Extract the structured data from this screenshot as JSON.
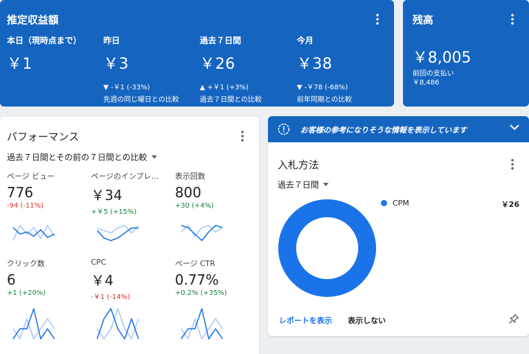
{
  "earnings": {
    "title": "推定収益額",
    "metrics": [
      {
        "label": "本日（現時点まで）",
        "value": "￥1",
        "change": "",
        "compare": ""
      },
      {
        "label": "昨日",
        "value": "￥3",
        "change": "▼ -￥1 (-33%)",
        "compare": "先週の同じ曜日との比較"
      },
      {
        "label": "過去７日間",
        "value": "￥26",
        "change": "▲ +￥1 (+3%)",
        "compare": "過去７日間との比較"
      },
      {
        "label": "今月",
        "value": "￥38",
        "change": "▼ -￥78 (-68%)",
        "compare": "前年同期との比較"
      }
    ]
  },
  "balance": {
    "title": "残高",
    "value": "￥8,005",
    "last_payment_label": "前回の支払い",
    "last_payment_value": "￥8,486"
  },
  "performance": {
    "title": "パフォーマンス",
    "period": "過去７日間とその前の７日間との比較",
    "metrics": [
      {
        "label": "ページ ビュー",
        "value": "776",
        "change": "-94 (-11%)",
        "trend": "down",
        "current": [
          20,
          14,
          16,
          12,
          18,
          11,
          14
        ],
        "previous": [
          8,
          22,
          14,
          20,
          10,
          22,
          12
        ]
      },
      {
        "label": "ページのインプレ…",
        "value": "￥34",
        "change": "+￥5 (+15%)",
        "trend": "up",
        "current": [
          18,
          12,
          10,
          12,
          16,
          20,
          20
        ],
        "previous": [
          20,
          18,
          16,
          20,
          22,
          16,
          22
        ]
      },
      {
        "label": "表示回数",
        "value": "800",
        "change": "+30 (+4%)",
        "trend": "up",
        "current": [
          20,
          18,
          12,
          6,
          14,
          20,
          18
        ],
        "previous": [
          14,
          20,
          10,
          18,
          20,
          14,
          18
        ]
      },
      {
        "label": "クリック数",
        "value": "6",
        "change": "+1 (+20%)",
        "trend": "up",
        "current": [
          0,
          1,
          1,
          3,
          0,
          1,
          0
        ],
        "previous": [
          1,
          0,
          2,
          0,
          1,
          2,
          1
        ]
      },
      {
        "label": "CPC",
        "value": "￥4",
        "change": "-￥1 (-14%)",
        "trend": "down",
        "current": [
          0,
          2,
          3,
          1,
          0,
          2,
          0
        ],
        "previous": [
          1,
          0,
          1,
          3,
          1,
          0,
          2
        ]
      },
      {
        "label": "ページ CTR",
        "value": "0.77%",
        "change": "+0.2% (+35%)",
        "trend": "up",
        "current": [
          0,
          1,
          1,
          3,
          0,
          1,
          0
        ],
        "previous": [
          1,
          0,
          2,
          0,
          1,
          2,
          1
        ]
      }
    ]
  },
  "banner": {
    "text": "お客様の参考になりそうな情報を表示しています"
  },
  "bid": {
    "title": "入札方法",
    "period": "過去７日間",
    "legend": [
      {
        "name": "CPM",
        "value": "￥26",
        "share": 1.0,
        "color": "#1a73e8"
      }
    ],
    "view_report": "レポートを表示",
    "hide": "表示しない"
  },
  "colors": {
    "primary_blue": "#1565c0",
    "series_current": "#1a73e8",
    "series_previous": "#a8c7fa",
    "negative": "#d93025",
    "positive": "#188038"
  }
}
